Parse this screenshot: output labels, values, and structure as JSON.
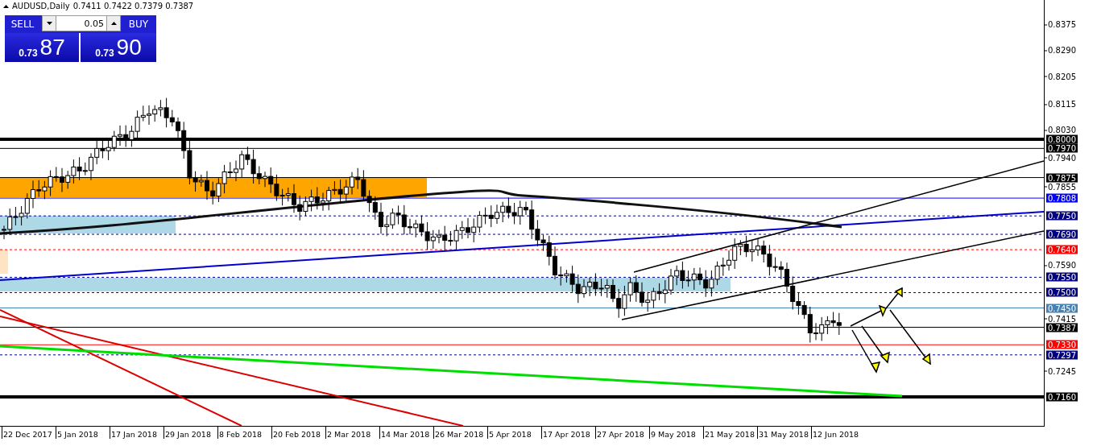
{
  "chart_header": {
    "symbol": "AUDUSD,Daily",
    "ohlc": "0.7411 0.7422 0.7379 0.7387"
  },
  "trade_panel": {
    "sell_label": "SELL",
    "buy_label": "BUY",
    "lot": "0.05",
    "sell_price_big": "0.73",
    "sell_price_pips": "87",
    "buy_price_big": "0.73",
    "buy_price_pips": "90"
  },
  "price_ticks": [
    "0.8375",
    "0.8290",
    "0.8205",
    "0.8115",
    "0.8030",
    "0.7940",
    "0.7855",
    "0.7590",
    "0.7415",
    "0.7245"
  ],
  "levels": [
    {
      "price": "0.8000",
      "color": "#000000",
      "kind": "thick"
    },
    {
      "price": "0.7970",
      "color": "#000000",
      "kind": "solid"
    },
    {
      "price": "0.7875",
      "color": "#000000",
      "kind": "solid"
    },
    {
      "price": "0.7808",
      "color": "#0000ff",
      "kind": "solid"
    },
    {
      "price": "0.7750",
      "color": "#000080",
      "kind": "dashed"
    },
    {
      "price": "0.7690",
      "color": "#000080",
      "kind": "dashed"
    },
    {
      "price": "0.7640",
      "color": "#ff0000",
      "kind": "dashed"
    },
    {
      "price": "0.7550",
      "color": "#000080",
      "kind": "dashed"
    },
    {
      "price": "0.7500",
      "color": "#000080",
      "kind": "dashed"
    },
    {
      "price": "0.7450",
      "color": "#4682b4",
      "kind": "solid"
    },
    {
      "price": "0.7387",
      "color": "#000000",
      "kind": "solid"
    },
    {
      "price": "0.7330",
      "color": "#ff0000",
      "kind": "solid"
    },
    {
      "price": "0.7297",
      "color": "#000080",
      "kind": "dashed"
    },
    {
      "price": "0.7160",
      "color": "#000000",
      "kind": "thick"
    }
  ],
  "date_ticks": [
    "22 Dec 2017",
    "5 Jan 2018",
    "17 Jan 2018",
    "29 Jan 2018",
    "8 Feb 2018",
    "20 Feb 2018",
    "2 Mar 2018",
    "14 Mar 2018",
    "26 Mar 2018",
    "5 Apr 2018",
    "17 Apr 2018",
    "27 Apr 2018",
    "9 May 2018",
    "21 May 2018",
    "31 May 2018",
    "12 Jun 2018"
  ]
}
